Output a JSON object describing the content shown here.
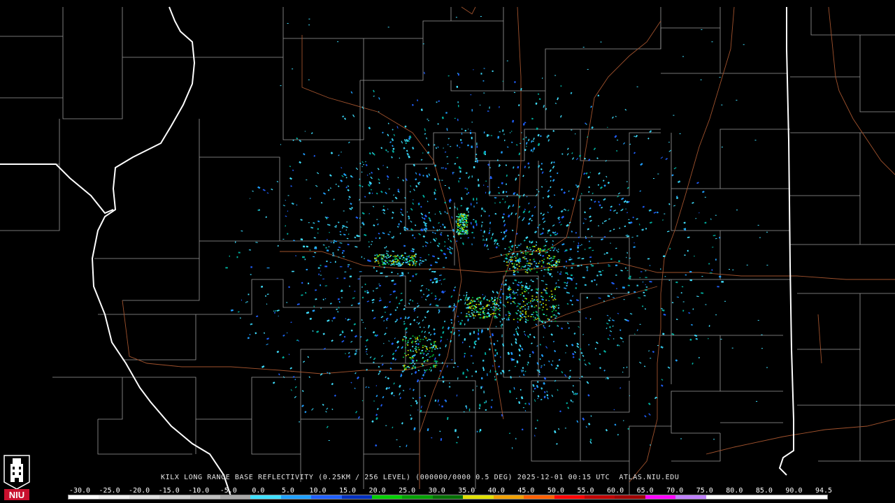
{
  "product_caption": "KILX LONG RANGE BASE REFLECTIVITY (0.25KM / 256 LEVEL) (000000/0000 0.5 DEG) 2025-12-01 00:15 UTC  ATLAS.NIU.EDU",
  "logo": {
    "text": "NIU",
    "icon": "niu-tower-logo"
  },
  "legend": {
    "ticks": [
      "-30.0",
      "-25.0",
      "-20.0",
      "-15.0",
      "-10.0",
      "-5.0",
      "0.0",
      "5.0",
      "10.0",
      "15.0",
      "20.0",
      "25.0",
      "30.0",
      "35.0",
      "40.0",
      "45.0",
      "50.0",
      "55.0",
      "60.0",
      "65.0",
      "70.0",
      "75.0",
      "80.0",
      "85.0",
      "90.0",
      "94.5"
    ],
    "colors": [
      "#ffffff",
      "#f0f0f0",
      "#e0e0e0",
      "#d0d0d0",
      "#c0c0c0",
      "#a8a8a8",
      "#40e0ff",
      "#20a0ff",
      "#2060ff",
      "#0030c0",
      "#00d000",
      "#00a000",
      "#007000",
      "#e0e000",
      "#f0a000",
      "#ff6000",
      "#ff0000",
      "#c00000",
      "#a00000",
      "#ff00ff",
      "#c080ff",
      "#ffffff",
      "#ffffff",
      "#ffffff",
      "#ffffff"
    ]
  },
  "colors": {
    "background": "#000000",
    "county_lines": "#9a9a9a",
    "state_lines": "#ffffff",
    "roads": "#a0522d"
  }
}
